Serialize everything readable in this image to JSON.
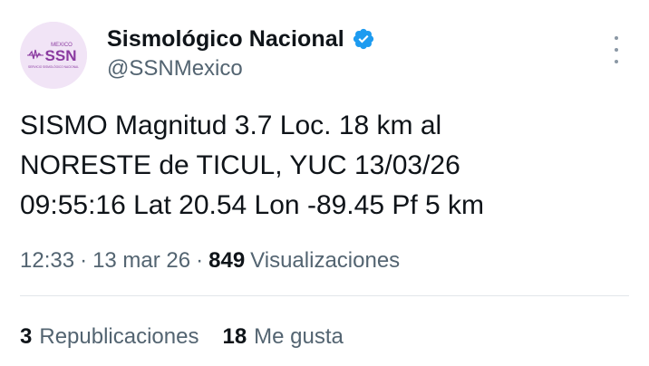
{
  "author": {
    "name": "Sismológico Nacional",
    "handle": "@SSNMexico",
    "avatar": {
      "logo_top": "MEXICO",
      "logo_main": "SSN",
      "logo_sub": "SERVICIO SISMOLÓGICO NACIONAL",
      "bg_color": "#f1e4f6",
      "accent_color": "#8a3aa0"
    },
    "verified_color": "#1d9bf0"
  },
  "tweet": {
    "lines": [
      "SISMO Magnitud 3.7 Loc. 18 km al",
      "NORESTE de TICUL, YUC 13/03/26",
      "09:55:16 Lat 20.54 Lon -89.45 Pf 5 km"
    ]
  },
  "meta": {
    "time": "12:33",
    "date": "13 mar 26",
    "separator": "·",
    "views_count": "849",
    "views_label": "Visualizaciones"
  },
  "stats": {
    "reposts_count": "3",
    "reposts_label": "Republicaciones",
    "likes_count": "18",
    "likes_label": "Me gusta"
  }
}
